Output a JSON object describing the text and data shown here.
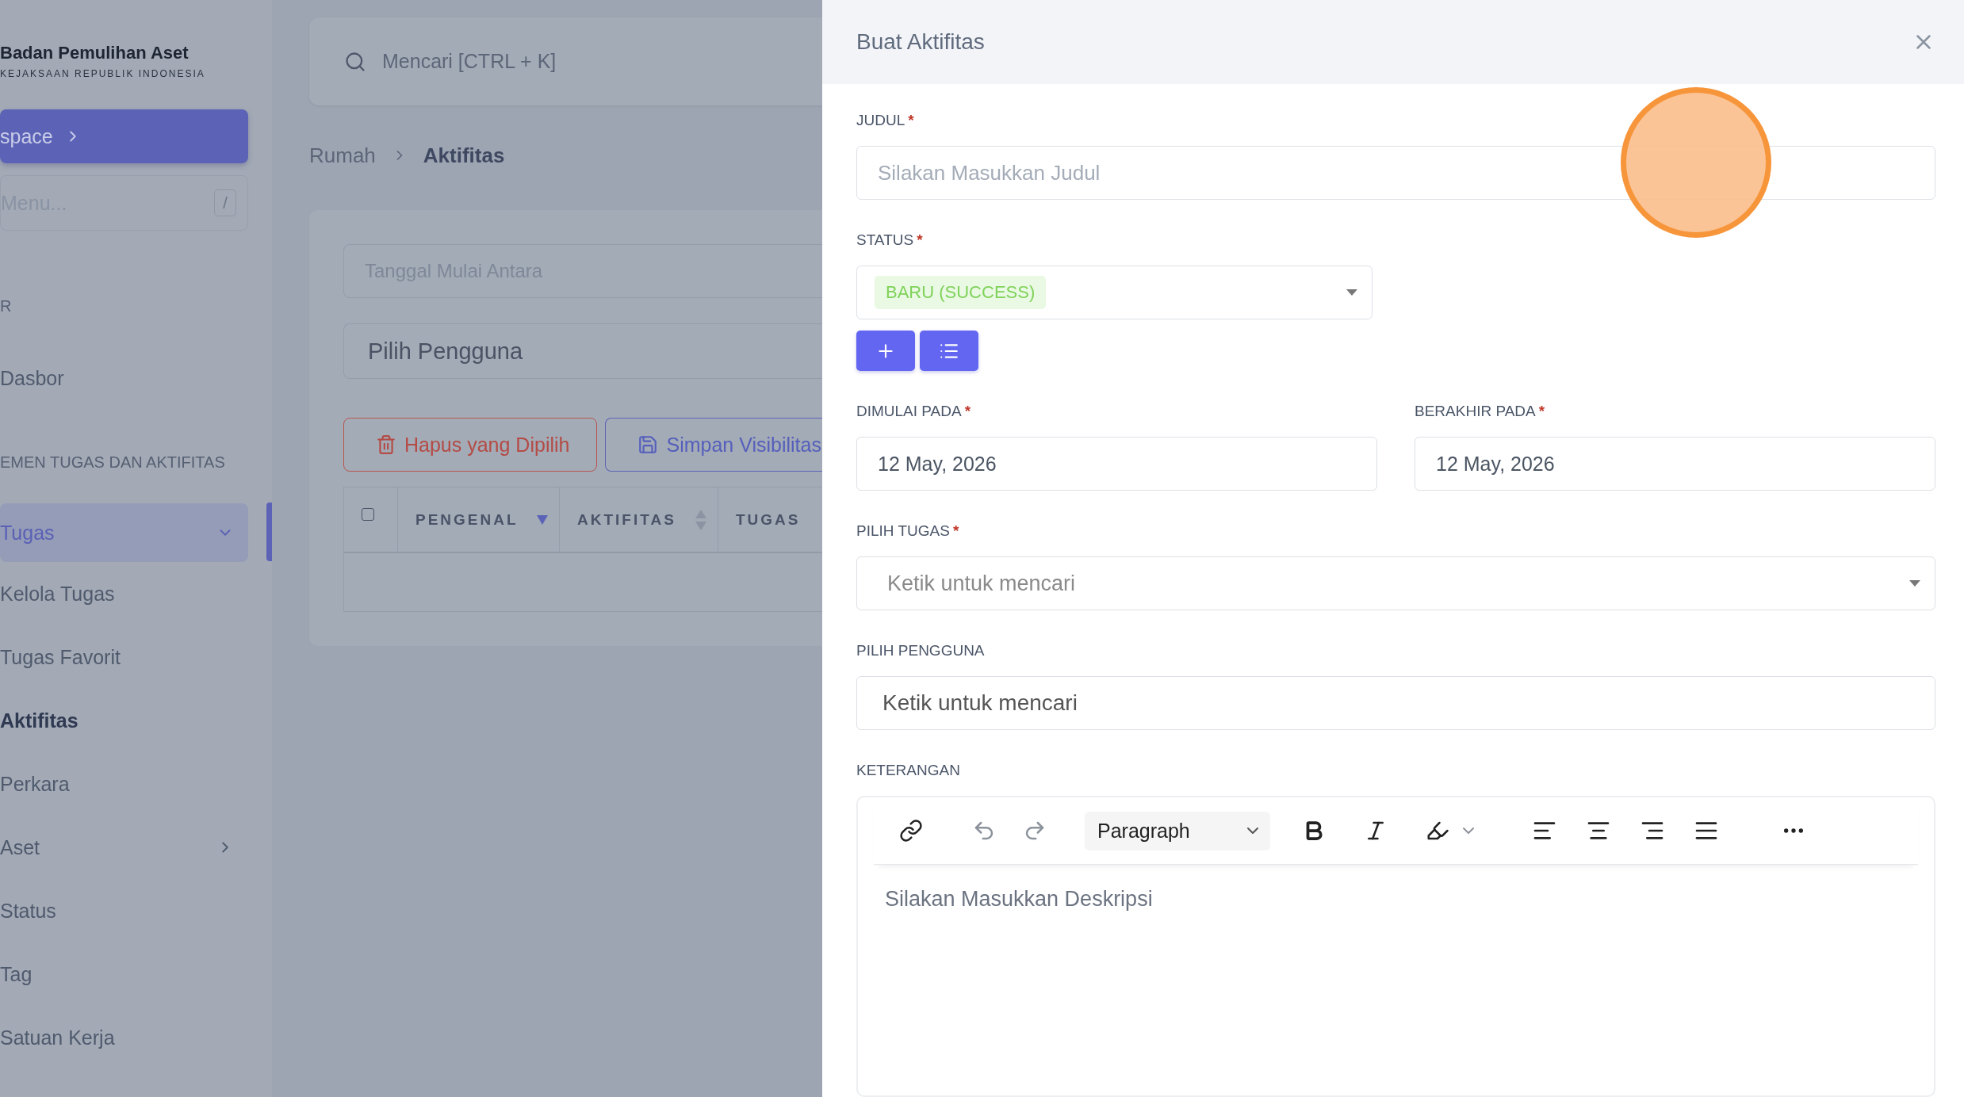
{
  "sidebar": {
    "brand": {
      "title": "Badan Pemulihan Aset",
      "subtitle": "KEJAKSAAN REPUBLIK INDONESIA"
    },
    "workspace_button": "space",
    "menu_search": {
      "placeholder": "Menu...",
      "shortcut": "/"
    },
    "sections": [
      {
        "heading": "R",
        "items": [
          {
            "label": "Dasbor",
            "selected": false
          }
        ]
      },
      {
        "heading": "EMEN TUGAS DAN AKTIFITAS",
        "items": [
          {
            "label": "Tugas",
            "selected": true,
            "expanded": true,
            "children": [
              {
                "label": "Kelola Tugas",
                "selected": false
              },
              {
                "label": "Tugas Favorit",
                "selected": false
              },
              {
                "label": "Aktifitas",
                "selected": true
              }
            ]
          },
          {
            "label": "Perkara",
            "selected": false
          },
          {
            "label": "Aset",
            "selected": false,
            "expanded": false
          },
          {
            "label": "Status",
            "selected": false
          },
          {
            "label": "Tag",
            "selected": false
          },
          {
            "label": "Satuan Kerja",
            "selected": false
          }
        ]
      }
    ]
  },
  "main": {
    "search": {
      "placeholder": "Mencari [CTRL + K]"
    },
    "breadcrumb": [
      "Rumah",
      "Aktifitas"
    ],
    "filters": {
      "date_placeholder": "Tanggal Mulai Antara",
      "user_placeholder": "Pilih Pengguna"
    },
    "buttons": [
      {
        "label": "Hapus yang Dipilih",
        "kind": "danger"
      },
      {
        "label": "Simpan Visibilitas",
        "kind": "primary"
      }
    ],
    "table": {
      "select_all": {
        "checked": false
      },
      "columns": [
        {
          "label": "PENGENAL",
          "sort_active": true
        },
        {
          "label": "AKTIFITAS",
          "sort_active": false
        },
        {
          "label": "TUGAS"
        }
      ]
    }
  },
  "drawer": {
    "title": "Buat Aktifitas",
    "fields": [
      {
        "kind": "text",
        "label": "JUDUL",
        "required_mark": "*",
        "placeholder": "Silakan Masukkan Judul"
      },
      {
        "kind": "status",
        "label": "STATUS",
        "required_mark": "*",
        "value": "BARU (SUCCESS)"
      },
      {
        "kind": "dates",
        "items": [
          {
            "label": "DIMULAI PADA",
            "required_mark": "*",
            "value": "12 May, 2026"
          },
          {
            "label": "BERAKHIR PADA",
            "required_mark": "*",
            "value": "12 May, 2026"
          }
        ]
      },
      {
        "kind": "select",
        "label": "PILIH TUGAS",
        "required_mark": "*",
        "placeholder": "Ketik untuk mencari"
      },
      {
        "kind": "search",
        "label": "PILIH PENGGUNA",
        "placeholder": "Ketik untuk mencari"
      },
      {
        "kind": "editor",
        "label": "KETERANGAN",
        "format": "Paragraph",
        "undo_disabled": true,
        "redo_disabled": true,
        "placeholder": "Silakan Masukkan Deskripsi"
      }
    ]
  }
}
